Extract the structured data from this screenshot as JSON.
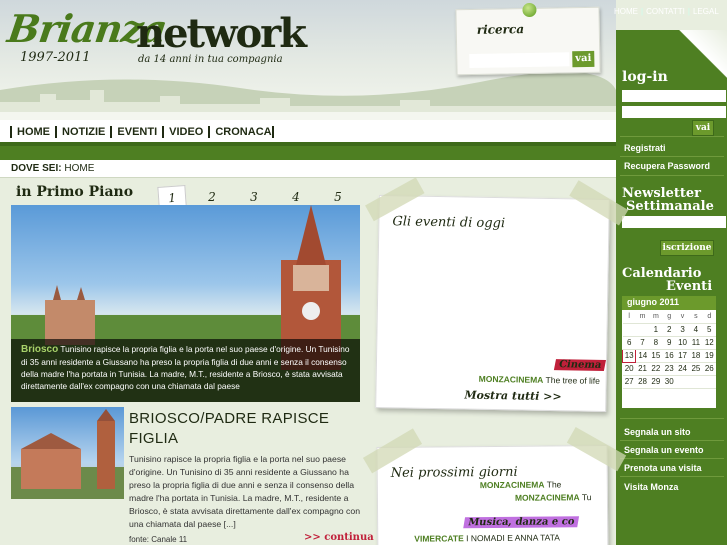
{
  "header": {
    "logo_brand": "Brianza",
    "logo_network": "network",
    "logo_years": "1997-2011",
    "logo_tagline": "da 14 anni in tua compagnia",
    "top_links": [
      "HOME",
      "CONTATTI",
      "LEGAL"
    ]
  },
  "search": {
    "label": "ricerca",
    "button": "vai",
    "value": ""
  },
  "nav": {
    "items": [
      "HOME",
      "NOTIZIE",
      "EVENTI",
      "VIDEO",
      "CRONACA"
    ]
  },
  "breadcrumb": {
    "label": "DOVE SEI:",
    "current": "HOME"
  },
  "primo_piano": {
    "title": "in Primo Piano",
    "pages": [
      "1",
      "2",
      "3",
      "4",
      "5"
    ],
    "active_page": "1",
    "hero_location": "Briosco",
    "hero_text": "Tunisino rapisce la propria figlia e la porta nel suo paese d'origine. Un Tunisino di 35 anni residente a Giussano ha preso la propria figlia di due anni e senza il consenso della madre l'ha portata in Tunisia. La madre, M.T., residente a Briosco, è stata avvisata direttamente dall'ex compagno con una chiamata dal paese"
  },
  "article": {
    "title": "BRIOSCO/PADRE RAPISCE FIGLIA",
    "text": "Tunisino rapisce la propria figlia e la porta nel suo paese d'origine. Un Tunisino di 35 anni residente a Giussano ha preso la propria figlia di due anni e senza il consenso della madre l'ha portata in Tunisia. La madre, M.T., residente a Briosco, è stata avvisata direttamente dall'ex compagno con una chiamata dal paese [...]",
    "source": "fonte: Canale 11",
    "more": ">> continua"
  },
  "events_today": {
    "title": "Gli eventi di oggi",
    "category": "Cinema",
    "items": [
      {
        "venue": "MONZACINEMA",
        "title": "The tree of life"
      }
    ],
    "more": "Mostra tutti >>"
  },
  "events_next": {
    "title": "Nei prossimi giorni",
    "items": [
      {
        "venue": "MONZACINEMA",
        "title": "The"
      },
      {
        "venue": "MONZACINEMA",
        "title": "Tu"
      }
    ],
    "category": "Musica, danza e co",
    "items2": [
      {
        "venue": "VIMERCATE",
        "title": "I NOMADI E ANNA TATA"
      }
    ]
  },
  "sidebar": {
    "login_title": "log-in",
    "login_button": "vai",
    "register": "Registrati",
    "recover": "Recupera Password",
    "newsletter_title_1": "Newsletter",
    "newsletter_title_2": "Settimanale",
    "newsletter_button": "iscrizione",
    "calendar_title_1": "Calendario",
    "calendar_title_2": "Eventi",
    "calendar_month": "giugno 2011",
    "calendar_days": [
      "l",
      "m",
      "m",
      "g",
      "v",
      "s",
      "d"
    ],
    "calendar_weeks": [
      [
        "",
        "",
        "1",
        "2",
        "3",
        "4",
        "5"
      ],
      [
        "6",
        "7",
        "8",
        "9",
        "10",
        "11",
        "12"
      ],
      [
        "13",
        "14",
        "15",
        "16",
        "17",
        "18",
        "19"
      ],
      [
        "20",
        "21",
        "22",
        "23",
        "24",
        "25",
        "26"
      ],
      [
        "27",
        "28",
        "29",
        "30",
        "",
        "",
        ""
      ]
    ],
    "calendar_today": "13",
    "links": [
      "Segnala un sito",
      "Segnala un evento",
      "Prenota una visita",
      "Visita Monza"
    ]
  },
  "colors": {
    "green": "#4e7f22",
    "dark": "#1f2a12",
    "accent": "#c0203a",
    "music": "#c070e0"
  }
}
